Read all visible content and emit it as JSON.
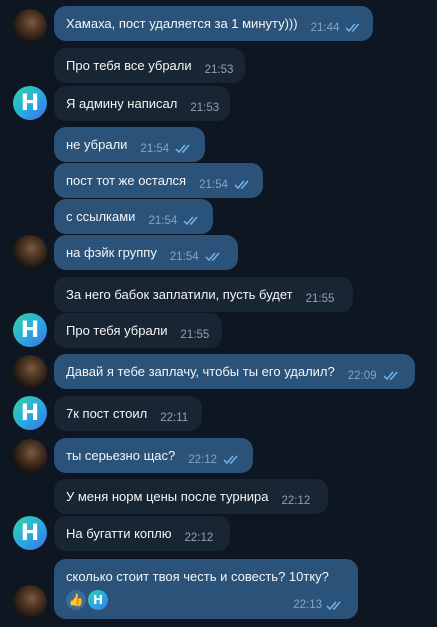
{
  "messages": [
    {
      "text": "Хамаха, пост удаляется за 1 минуту)))",
      "time": "21:44"
    },
    {
      "text": "Про тебя все убрали",
      "time": "21:53"
    },
    {
      "text": "Я админу написал",
      "time": "21:53"
    },
    {
      "text": "не убрали",
      "time": "21:54"
    },
    {
      "text": "пост тот же остался",
      "time": "21:54"
    },
    {
      "text": "с ссылками",
      "time": "21:54"
    },
    {
      "text": "на фэйк группу",
      "time": "21:54"
    },
    {
      "text": "За него бабок заплатили, пусть будет",
      "time": "21:55"
    },
    {
      "text": "Про тебя убрали",
      "time": "21:55"
    },
    {
      "text": "Давай я тебе заплачу, чтобы ты его удалил?",
      "time": "22:09"
    },
    {
      "text": "7к пост стоил",
      "time": "22:11"
    },
    {
      "text": "ты серьезно щас?",
      "time": "22:12"
    },
    {
      "text": "У меня норм цены после турнира",
      "time": "22:12"
    },
    {
      "text": "На бугатти коплю",
      "time": "22:12"
    },
    {
      "text": "сколько стоит твоя честь и совесть? 10тку?",
      "time": "22:13"
    }
  ],
  "reactions": [
    "👍",
    "H"
  ],
  "avatar_letter": "H",
  "colors": {
    "background": "#0e1621",
    "incoming": "#182533",
    "outgoing": "#2b5278",
    "check": "#6fb6f2"
  }
}
